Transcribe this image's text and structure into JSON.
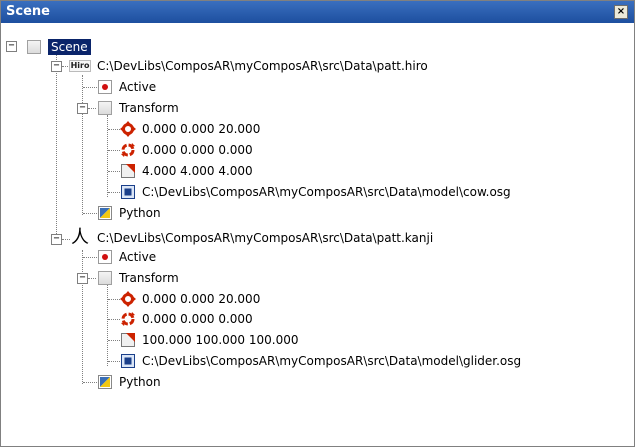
{
  "window": {
    "title": "Scene",
    "close_glyph": "×"
  },
  "tree": {
    "root": {
      "label": "Scene"
    },
    "markers": [
      {
        "path": "C:\\DevLibs\\ComposAR\\myComposAR\\src\\Data\\patt.hiro",
        "icon": "hiro-marker-icon",
        "icon_text": "Hiro",
        "active": "Active",
        "transform": "Transform",
        "position": "0.000 0.000 20.000",
        "rotation": "0.000 0.000 0.000",
        "scale": "4.000 4.000 4.000",
        "model": "C:\\DevLibs\\ComposAR\\myComposAR\\src\\Data\\model\\cow.osg",
        "python": "Python"
      },
      {
        "path": "C:\\DevLibs\\ComposAR\\myComposAR\\src\\Data\\patt.kanji",
        "icon": "kanji-marker-icon",
        "icon_text": "人",
        "active": "Active",
        "transform": "Transform",
        "position": "0.000 0.000 20.000",
        "rotation": "0.000 0.000 0.000",
        "scale": "100.000 100.000 100.000",
        "model": "C:\\DevLibs\\ComposAR\\myComposAR\\src\\Data\\model\\glider.osg",
        "python": "Python"
      }
    ]
  },
  "colors": {
    "titlebar": "#1d4f9f",
    "selection": "#0a246a",
    "active_dot": "#d01010",
    "transform_icon": "#cc2200",
    "model_icon": "#1a3f8a"
  }
}
